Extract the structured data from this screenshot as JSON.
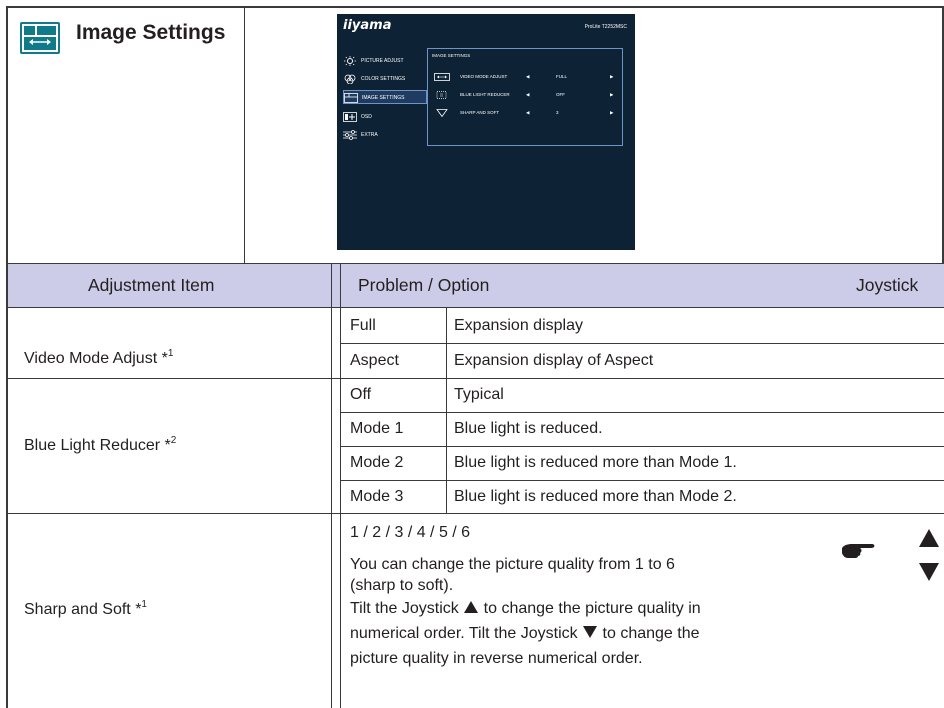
{
  "section": {
    "title": "Image Settings",
    "icon": "image-settings-icon"
  },
  "osd": {
    "logo": "iiyama",
    "model": "ProLite T2252MSC",
    "menu": [
      {
        "label": "PICTURE ADJUST",
        "icon": "brightness-icon"
      },
      {
        "label": "COLOR SETTINGS",
        "icon": "color-wheel-icon"
      },
      {
        "label": "IMAGE SETTINGS",
        "icon": "image-settings-icon",
        "active": true
      },
      {
        "label": "OSD",
        "icon": "osd-icon"
      },
      {
        "label": "EXTRA",
        "icon": "sliders-icon"
      }
    ],
    "panel_title": "IMAGE SETTINGS",
    "rows": [
      {
        "label": "VIDEO MODE ADJUST",
        "value": "FULL",
        "icon": "aspect-icon"
      },
      {
        "label": "BLUE LIGHT REDUCER",
        "value": "OFF",
        "icon": "blue-light-icon"
      },
      {
        "label": "SHARP AND SOFT",
        "value": "3",
        "icon": "triangle-down-icon"
      }
    ],
    "left_arrow": "◀",
    "right_arrow": "▶"
  },
  "table": {
    "headers": {
      "item": "Adjustment Item",
      "problem": "Problem / Option",
      "joystick": "Joystick"
    },
    "video_mode": {
      "label": "Video Mode Adjust *",
      "note": "1",
      "options": [
        {
          "option": "Full",
          "desc": "Expansion display"
        },
        {
          "option": "Aspect",
          "desc": "Expansion display of Aspect"
        }
      ]
    },
    "blue_light": {
      "label": "Blue Light Reducer *",
      "note": "2",
      "options": [
        {
          "option": "Off",
          "desc": "Typical"
        },
        {
          "option": "Mode 1",
          "desc": "Blue light is reduced."
        },
        {
          "option": "Mode 2",
          "desc": "Blue light is reduced more than Mode 1."
        },
        {
          "option": "Mode 3",
          "desc": "Blue light is reduced more than Mode 2."
        }
      ]
    },
    "sharp_soft": {
      "label": "Sharp and Soft *",
      "note": "1",
      "values": "1 / 2 / 3 / 4 / 5 / 6",
      "line1": "You can change the picture quality from 1 to 6",
      "line2": "(sharp to soft).",
      "line3a": "Tilt the Joystick",
      "line3b": "to change the picture quality in",
      "line4a": "numerical order. Tilt the Joystick",
      "line4b": "to change the",
      "line5": "picture quality in reverse numerical order."
    },
    "joystick_icons": [
      "hand-pointer-icon",
      "triangle-up-icon",
      "triangle-down-icon"
    ]
  }
}
